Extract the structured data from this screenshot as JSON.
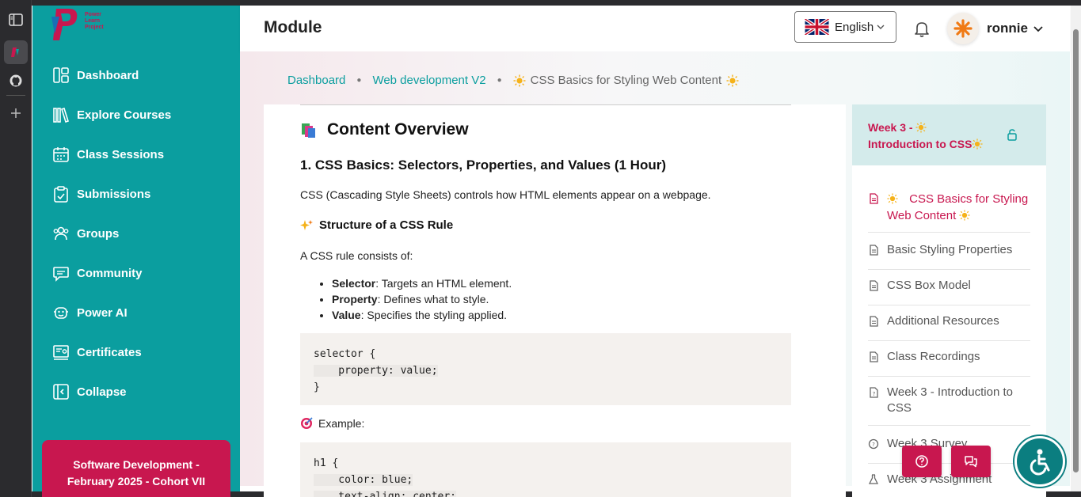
{
  "app": {
    "logo_text": [
      "Power",
      "Learn",
      "Project"
    ],
    "brand_color": "#0b9e9f",
    "accent_color": "#c8174f"
  },
  "browser_strip": {
    "icons": [
      "sidebar-toggle-icon",
      "app-tab-icon",
      "github-icon",
      "plus-icon"
    ]
  },
  "sidebar": {
    "items": [
      {
        "label": "Dashboard",
        "icon": "dashboard-icon"
      },
      {
        "label": "Explore Courses",
        "icon": "books-icon"
      },
      {
        "label": "Class Sessions",
        "icon": "calendar-icon"
      },
      {
        "label": "Submissions",
        "icon": "clipboard-icon"
      },
      {
        "label": "Groups",
        "icon": "users-icon"
      },
      {
        "label": "Community",
        "icon": "chat-icon"
      },
      {
        "label": "Power AI",
        "icon": "robot-icon"
      },
      {
        "label": "Certificates",
        "icon": "certificate-icon"
      },
      {
        "label": "Collapse",
        "icon": "collapse-icon"
      }
    ],
    "cohort_line1": "Software Development -",
    "cohort_line2": "February 2025 - Cohort VII"
  },
  "header": {
    "title": "Module",
    "language": "English",
    "user_name": "ronnie"
  },
  "breadcrumb": {
    "items": [
      "Dashboard",
      "Web development V2"
    ],
    "current": "CSS Basics for Styling Web Content"
  },
  "content": {
    "overview_title": "Content Overview",
    "section_title": "1. CSS Basics: Selectors, Properties, and Values (1 Hour)",
    "intro": "CSS (Cascading Style Sheets) controls how HTML elements appear on a webpage.",
    "rule_heading": "Structure of a CSS Rule",
    "rule_intro": "A CSS rule consists of:",
    "bullets": [
      {
        "term": "Selector",
        "desc": ": Targets an HTML element."
      },
      {
        "term": "Property",
        "desc": ": Defines what to style."
      },
      {
        "term": "Value",
        "desc": ": Specifies the styling applied."
      }
    ],
    "code1": [
      "selector {",
      "    property: value;",
      "}"
    ],
    "example_label": "Example:",
    "code2": [
      "h1 {",
      "    color: blue;",
      "    text-align: center;"
    ]
  },
  "side_panel": {
    "week_title_line1": "Week 3 -",
    "week_title_line2": "Introduction to CSS",
    "lessons": [
      {
        "label": "CSS Basics for Styling Web Content",
        "active": true
      },
      {
        "label": "Basic Styling Properties"
      },
      {
        "label": "CSS Box Model"
      },
      {
        "label": "Additional Resources"
      },
      {
        "label": "Class Recordings"
      },
      {
        "label": "Week 3 - Introduction to CSS"
      },
      {
        "label": "Week 3 Survey"
      },
      {
        "label": "Week 3 Assignment"
      }
    ]
  }
}
